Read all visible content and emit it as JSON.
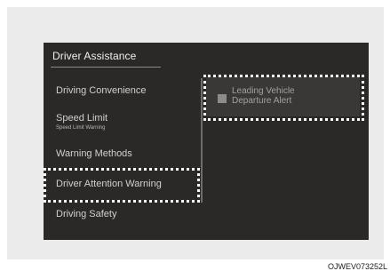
{
  "screen": {
    "title": "Driver Assistance"
  },
  "menu": {
    "items": [
      {
        "label": "Driving Convenience"
      },
      {
        "label": "Speed Limit",
        "sublabel": "Speed Limit Warning"
      },
      {
        "label": "Warning Methods"
      },
      {
        "label": "Driver Attention Warning"
      },
      {
        "label": "Driving Safety"
      }
    ]
  },
  "option": {
    "line1": "Leading Vehicle",
    "line2": "Departure Alert",
    "checked": false
  },
  "caption": "OJWEV073252L"
}
